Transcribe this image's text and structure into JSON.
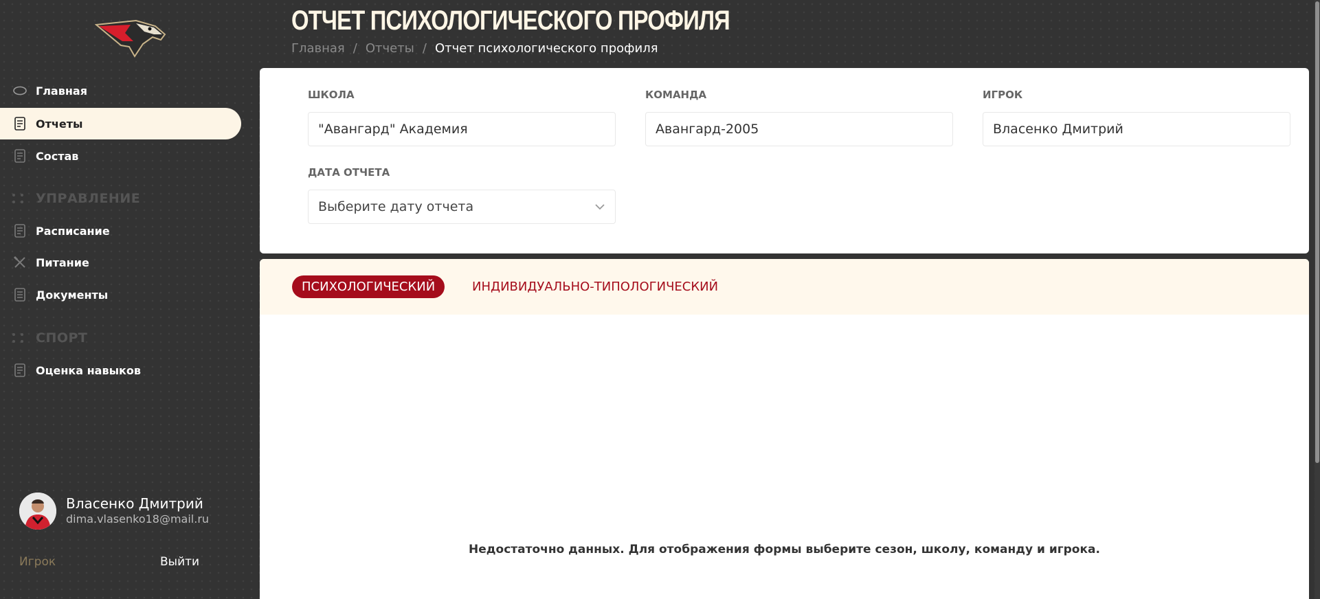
{
  "header": {
    "title": "ОТЧЕТ ПСИХОЛОГИЧЕСКОГО ПРОФИЛЯ",
    "breadcrumb": [
      "Главная",
      "Отчеты",
      "Отчет психологического профиля"
    ],
    "separator": "/"
  },
  "sidebar": {
    "items": [
      {
        "label": "Главная",
        "icon": "puck-icon"
      },
      {
        "label": "Отчеты",
        "icon": "report-icon",
        "active": true
      },
      {
        "label": "Состав",
        "icon": "document-icon"
      }
    ],
    "section_management": "УПРАВЛЕНИЕ",
    "management_items": [
      {
        "label": "Расписание",
        "icon": "document-icon"
      },
      {
        "label": "Питание",
        "icon": "cutlery-icon"
      },
      {
        "label": "Документы",
        "icon": "document-icon"
      }
    ],
    "section_sport": "СПОРТ",
    "sport_items": [
      {
        "label": "Оценка навыков",
        "icon": "document-icon"
      }
    ],
    "user": {
      "name": "Власенко Дмитрий",
      "email": "dima.vlasenko18@mail.ru",
      "role": "Игрок",
      "logout": "Выйти"
    }
  },
  "filters": {
    "school": {
      "label": "ШКОЛА",
      "value": "\"Авангард\" Академия"
    },
    "team": {
      "label": "КОМАНДА",
      "value": "Авангард-2005"
    },
    "player": {
      "label": "ИГРОК",
      "value": "Власенко Дмитрий"
    },
    "report_date": {
      "label": "ДАТА ОТЧЕТА",
      "placeholder": "Выберите дату отчета"
    }
  },
  "tabs": [
    {
      "label": "ПСИХОЛОГИЧЕСКИЙ",
      "active": true
    },
    {
      "label": "ИНДИВИДУАЛЬНО-ТИПОЛОГИЧЕСКИЙ",
      "active": false
    }
  ],
  "empty_message": "Недостаточно данных. Для отображения формы выберите сезон, школу, команду и игрока.",
  "colors": {
    "accent": "#a50d1c",
    "sidebar_bg": "#333333",
    "active_nav_bg": "#fdf5e6",
    "tabs_bg": "#fff8ec"
  }
}
